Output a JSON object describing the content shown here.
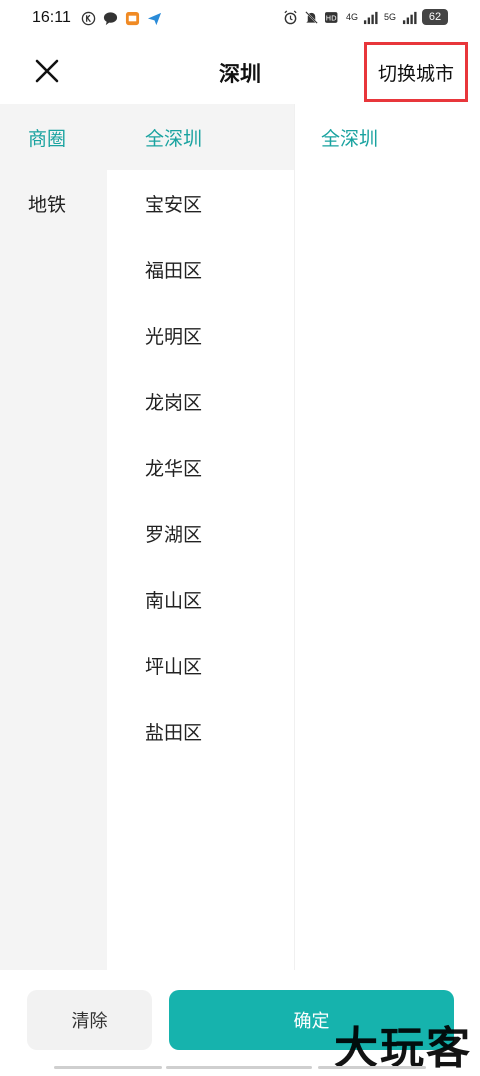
{
  "status_bar": {
    "time": "16:11",
    "net_4g": "4G",
    "net_5g": "5G",
    "battery": "62"
  },
  "header": {
    "title": "深圳",
    "switch_city": "切换城市"
  },
  "col1": {
    "items": [
      {
        "label": "商圈"
      },
      {
        "label": "地铁"
      }
    ]
  },
  "col2": {
    "items": [
      {
        "label": "全深圳"
      },
      {
        "label": "宝安区"
      },
      {
        "label": "福田区"
      },
      {
        "label": "光明区"
      },
      {
        "label": "龙岗区"
      },
      {
        "label": "龙华区"
      },
      {
        "label": "罗湖区"
      },
      {
        "label": "南山区"
      },
      {
        "label": "坪山区"
      },
      {
        "label": "盐田区"
      }
    ]
  },
  "col3": {
    "items": [
      {
        "label": "全深圳"
      }
    ]
  },
  "bottom": {
    "clear": "清除",
    "confirm": "确定",
    "watermark": "大玩客"
  },
  "colors": {
    "accent": "#1aa3a0",
    "confirm_bg": "#16b3ad",
    "highlight_border": "#e8363b"
  }
}
